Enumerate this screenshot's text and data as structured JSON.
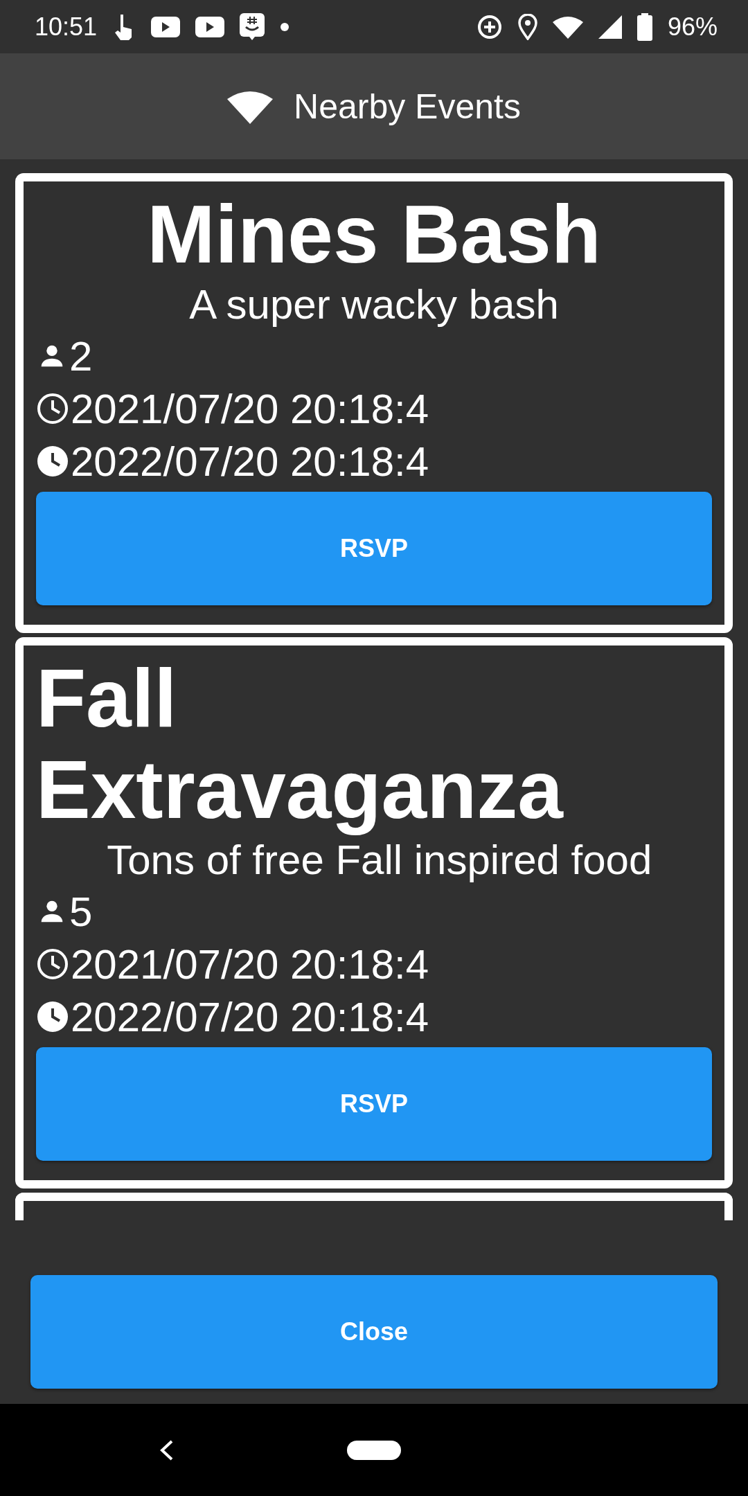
{
  "status_bar": {
    "time": "10:51",
    "battery": "96%"
  },
  "header": {
    "title": "Nearby Events"
  },
  "events": [
    {
      "title": "Mines Bash",
      "centered": true,
      "description": "A super wacky bash",
      "attendees": "2",
      "start": "2021/07/20 20:18:4",
      "end": "2022/07/20 20:18:4",
      "button": "RSVP"
    },
    {
      "title": "Fall Extravaganza",
      "centered": false,
      "description": " Tons of free Fall inspired food",
      "attendees": "5",
      "start": "2021/07/20 20:18:4",
      "end": "2022/07/20 20:18:4",
      "button": "RSVP"
    }
  ],
  "close_button": "Close"
}
